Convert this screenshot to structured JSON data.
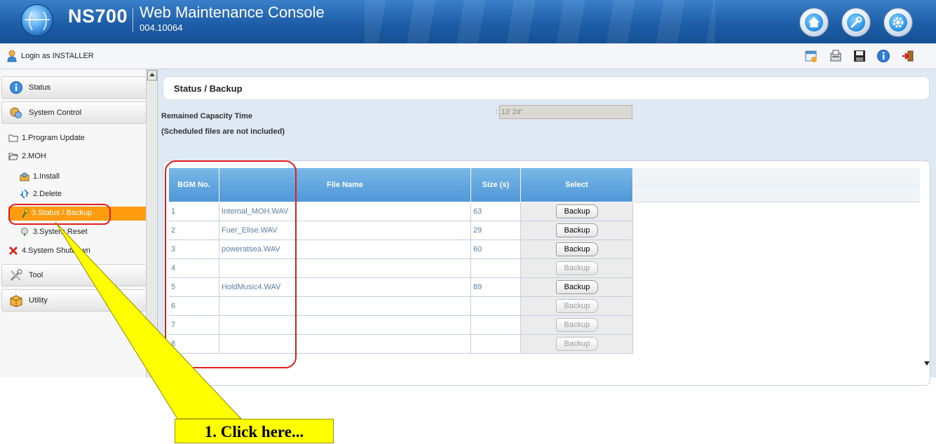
{
  "header": {
    "model": "NS700",
    "title": "Web Maintenance Console",
    "version": "004.10064",
    "buttons": [
      "home-icon",
      "wrench-icon",
      "gear-icon"
    ]
  },
  "login": {
    "text": "Login as INSTALLER",
    "tools": [
      "calendar-icon",
      "fax-icon",
      "save-icon",
      "info-icon",
      "logout-icon"
    ]
  },
  "sidebar": {
    "sections": {
      "status": "Status",
      "system_control": "System Control",
      "tool": "Tool",
      "utility": "Utility"
    },
    "items": {
      "program_update": "1.Program Update",
      "moh": "2.MOH",
      "install": "1.Install",
      "delete": "2.Delete",
      "status_backup": "3.Status / Backup",
      "system_reset": "3.System Reset",
      "system_shutdown": "4.System Shutdown"
    }
  },
  "main": {
    "title": "Status / Backup",
    "remained_label": "Remained Capacity Time",
    "scheduled_note": "(Scheduled files are not included)",
    "colon": ":",
    "remained_value": "13' 24\"",
    "table": {
      "headers": {
        "bgm": "BGM No.",
        "file": "File Name",
        "size": "Size (s)",
        "select": "Select"
      },
      "rows": [
        {
          "bgm": "1",
          "file": "Internal_MOH.WAV",
          "size": "63",
          "button": "Backup",
          "enabled": true
        },
        {
          "bgm": "2",
          "file": "Fuer_Elise.WAV",
          "size": "29",
          "button": "Backup",
          "enabled": true
        },
        {
          "bgm": "3",
          "file": "poweratsea.WAV",
          "size": "60",
          "button": "Backup",
          "enabled": true
        },
        {
          "bgm": "4",
          "file": "",
          "size": "",
          "button": "Backup",
          "enabled": false
        },
        {
          "bgm": "5",
          "file": "HoldMusic4.WAV",
          "size": "89",
          "button": "Backup",
          "enabled": true
        },
        {
          "bgm": "6",
          "file": "",
          "size": "",
          "button": "Backup",
          "enabled": false
        },
        {
          "bgm": "7",
          "file": "",
          "size": "",
          "button": "Backup",
          "enabled": false
        },
        {
          "bgm": "8",
          "file": "",
          "size": "",
          "button": "Backup",
          "enabled": false
        }
      ]
    }
  },
  "annotation": {
    "callout": "1. Click here...",
    "colors": {
      "highlight": "#e02020",
      "callout": "#ffff00",
      "active": "#ff9c0f"
    }
  }
}
